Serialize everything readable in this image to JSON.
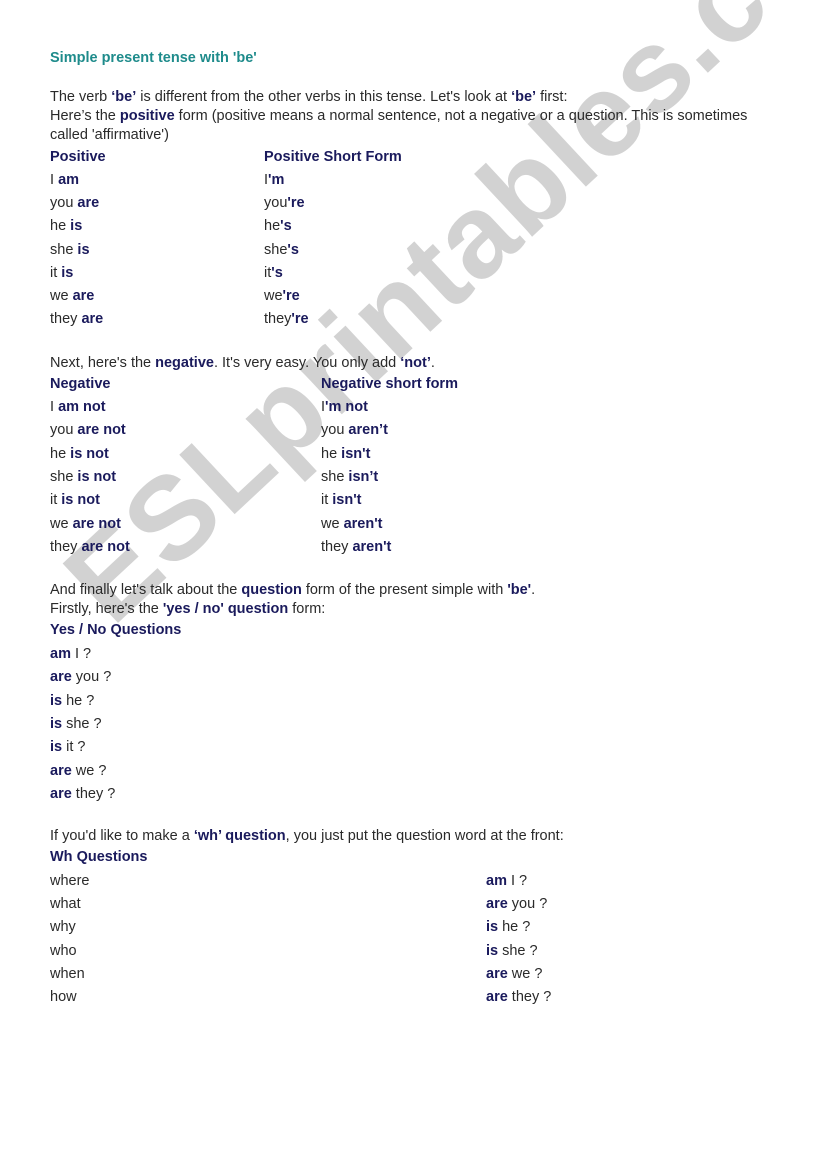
{
  "watermark": "ESLprintables.com",
  "title": "Simple present tense with 'be'",
  "intro": {
    "line1": [
      {
        "t": "The verb ",
        "b": false
      },
      {
        "t": "‘be’",
        "b": true
      },
      {
        "t": " is different from the other verbs in this tense. Let's look at ",
        "b": false
      },
      {
        "t": "‘be’",
        "b": true
      },
      {
        "t": " first:",
        "b": false
      }
    ],
    "line2": [
      {
        "t": "Here’s the ",
        "b": false
      },
      {
        "t": "positive",
        "b": true
      },
      {
        "t": " form (positive means a normal sentence, not a negative or a question. This is sometimes called 'affirmative')",
        "b": false
      }
    ]
  },
  "positive": {
    "headers": [
      "Positive",
      "Positive Short Form"
    ],
    "rows": [
      [
        [
          {
            "t": "I ",
            "b": false
          },
          {
            "t": "am",
            "b": true
          }
        ],
        [
          {
            "t": "I",
            "b": false
          },
          {
            "t": "'m",
            "b": true
          }
        ]
      ],
      [
        [
          {
            "t": "you ",
            "b": false
          },
          {
            "t": "are",
            "b": true
          }
        ],
        [
          {
            "t": "you",
            "b": false
          },
          {
            "t": "'re",
            "b": true
          }
        ]
      ],
      [
        [
          {
            "t": "he ",
            "b": false
          },
          {
            "t": "is",
            "b": true
          }
        ],
        [
          {
            "t": "he",
            "b": false
          },
          {
            "t": "'s",
            "b": true
          }
        ]
      ],
      [
        [
          {
            "t": "she ",
            "b": false
          },
          {
            "t": "is",
            "b": true
          }
        ],
        [
          {
            "t": "she",
            "b": false
          },
          {
            "t": "'s",
            "b": true
          }
        ]
      ],
      [
        [
          {
            "t": "it ",
            "b": false
          },
          {
            "t": "is",
            "b": true
          }
        ],
        [
          {
            "t": "it",
            "b": false
          },
          {
            "t": "'s",
            "b": true
          }
        ]
      ],
      [
        [
          {
            "t": "we ",
            "b": false
          },
          {
            "t": "are",
            "b": true
          }
        ],
        [
          {
            "t": "we",
            "b": false
          },
          {
            "t": "'re",
            "b": true
          }
        ]
      ],
      [
        [
          {
            "t": "they ",
            "b": false
          },
          {
            "t": "are",
            "b": true
          }
        ],
        [
          {
            "t": "they",
            "b": false
          },
          {
            "t": "'re",
            "b": true
          }
        ]
      ]
    ]
  },
  "negative_intro": [
    {
      "t": "Next, here's the ",
      "b": false
    },
    {
      "t": "negative",
      "b": true
    },
    {
      "t": ". It's very easy. You only add ",
      "b": false
    },
    {
      "t": "‘not’",
      "b": true
    },
    {
      "t": ".",
      "b": false
    }
  ],
  "negative": {
    "headers": [
      "Negative",
      "Negative short form"
    ],
    "rows": [
      [
        [
          {
            "t": "I ",
            "b": false
          },
          {
            "t": "am not",
            "b": true
          }
        ],
        [
          {
            "t": "I",
            "b": false
          },
          {
            "t": "'m not",
            "b": true
          }
        ]
      ],
      [
        [
          {
            "t": "you ",
            "b": false
          },
          {
            "t": "are not",
            "b": true
          }
        ],
        [
          {
            "t": "you ",
            "b": false
          },
          {
            "t": "aren’t",
            "b": true
          }
        ]
      ],
      [
        [
          {
            "t": "he ",
            "b": false
          },
          {
            "t": "is not",
            "b": true
          }
        ],
        [
          {
            "t": "he ",
            "b": false
          },
          {
            "t": "isn't",
            "b": true
          }
        ]
      ],
      [
        [
          {
            "t": "she ",
            "b": false
          },
          {
            "t": "is not",
            "b": true
          }
        ],
        [
          {
            "t": "she ",
            "b": false
          },
          {
            "t": "isn’t",
            "b": true
          }
        ]
      ],
      [
        [
          {
            "t": "it ",
            "b": false
          },
          {
            "t": "is not",
            "b": true
          }
        ],
        [
          {
            "t": "it ",
            "b": false
          },
          {
            "t": "isn't",
            "b": true
          }
        ]
      ],
      [
        [
          {
            "t": "we ",
            "b": false
          },
          {
            "t": "are not",
            "b": true
          }
        ],
        [
          {
            "t": "we ",
            "b": false
          },
          {
            "t": "aren't",
            "b": true
          }
        ]
      ],
      [
        [
          {
            "t": "they ",
            "b": false
          },
          {
            "t": "are not",
            "b": true
          }
        ],
        [
          {
            "t": "they ",
            "b": false
          },
          {
            "t": "aren't",
            "b": true
          }
        ]
      ]
    ]
  },
  "question_intro": {
    "line1": [
      {
        "t": "And finally let's talk about the ",
        "b": false
      },
      {
        "t": "question",
        "b": true
      },
      {
        "t": " form of the present simple with ",
        "b": false
      },
      {
        "t": "'be'",
        "b": true
      },
      {
        "t": ".",
        "b": false
      }
    ],
    "line2": [
      {
        "t": "Firstly, here's the ",
        "b": false
      },
      {
        "t": "'yes / no' question",
        "b": true
      },
      {
        "t": " form:",
        "b": false
      }
    ]
  },
  "yes_no": {
    "header": "Yes / No Questions",
    "rows": [
      [
        {
          "t": "am",
          "b": true
        },
        {
          "t": " I ?",
          "b": false
        }
      ],
      [
        {
          "t": "are",
          "b": true
        },
        {
          "t": " you ?",
          "b": false
        }
      ],
      [
        {
          "t": "is",
          "b": true
        },
        {
          "t": " he ?",
          "b": false
        }
      ],
      [
        {
          "t": "is",
          "b": true
        },
        {
          "t": " she ?",
          "b": false
        }
      ],
      [
        {
          "t": "is",
          "b": true
        },
        {
          "t": " it ?",
          "b": false
        }
      ],
      [
        {
          "t": "are",
          "b": true
        },
        {
          "t": " we ?",
          "b": false
        }
      ],
      [
        {
          "t": "are",
          "b": true
        },
        {
          "t": " they ?",
          "b": false
        }
      ]
    ]
  },
  "wh_intro": [
    {
      "t": "If you'd like to make a ",
      "b": false
    },
    {
      "t": "‘wh’ question",
      "b": true
    },
    {
      "t": ", you just put the question word at the front:",
      "b": false
    }
  ],
  "wh": {
    "header": "Wh Questions",
    "words": [
      "where",
      "what",
      "why",
      "who",
      "when",
      "how"
    ],
    "questions": [
      [
        {
          "t": "am",
          "b": true
        },
        {
          "t": " I ?",
          "b": false
        }
      ],
      [
        {
          "t": "are",
          "b": true
        },
        {
          "t": " you ?",
          "b": false
        }
      ],
      [
        {
          "t": "is",
          "b": true
        },
        {
          "t": " he ?",
          "b": false
        }
      ],
      [
        {
          "t": "is",
          "b": true
        },
        {
          "t": " she ?",
          "b": false
        }
      ],
      [
        {
          "t": "are",
          "b": true
        },
        {
          "t": " we ?",
          "b": false
        }
      ],
      [
        {
          "t": "are",
          "b": true
        },
        {
          "t": " they ?",
          "b": false
        }
      ]
    ]
  },
  "colors": {
    "title": "#1e8b8b",
    "bold": "#1a1a5c",
    "text": "#2a2a2a",
    "watermark": "#d2d2d2"
  }
}
